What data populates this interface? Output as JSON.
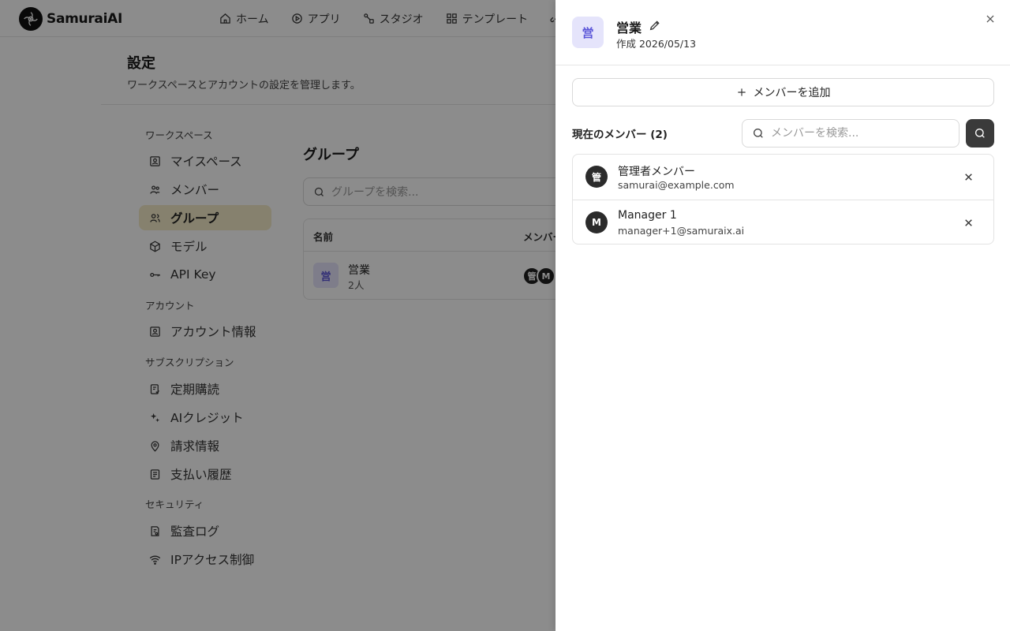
{
  "app": {
    "brand": "SamuraiAI",
    "nav": [
      {
        "label": "ホーム",
        "icon": "home-icon"
      },
      {
        "label": "アプリ",
        "icon": "play-circle-icon"
      },
      {
        "label": "スタジオ",
        "icon": "nodes-icon"
      },
      {
        "label": "テンプレート",
        "icon": "grid-icon"
      }
    ]
  },
  "settings": {
    "title": "設定",
    "subtitle": "ワークスペースとアカウントの設定を管理します。",
    "sections": {
      "workspace": "ワークスペース",
      "account": "アカウント",
      "subscription": "サブスクリプション",
      "security": "セキュリティ"
    },
    "items": {
      "myspace": "マイスペース",
      "members": "メンバー",
      "groups": "グループ",
      "models": "モデル",
      "apikey": "API Key",
      "account_info": "アカウント情報",
      "subscription_plan": "定期購読",
      "ai_credit": "AIクレジット",
      "billing": "請求情報",
      "payment_history": "支払い履歴",
      "audit_log": "監査ログ",
      "ip_access": "IPアクセス制御"
    }
  },
  "groups_page": {
    "title": "グループ",
    "search_placeholder": "グループを検索...",
    "columns": {
      "name": "名前",
      "members": "メンバー"
    },
    "rows": [
      {
        "badge": "営",
        "name": "営業",
        "count": "2人",
        "avatars": [
          "管",
          "M"
        ]
      }
    ]
  },
  "drawer": {
    "group_badge": "営",
    "group_name": "営業",
    "created": "作成 2026/05/13",
    "add_member_label": "メンバーを追加",
    "members_title": "現在のメンバー (2)",
    "member_search_placeholder": "メンバーを検索...",
    "members": [
      {
        "initial": "管",
        "name": "管理者メンバー",
        "email": "samurai@example.com"
      },
      {
        "initial": "M",
        "name": "Manager 1",
        "email": "manager+1@samuraix.ai"
      }
    ]
  },
  "colors": {
    "accent_badge_bg": "#e5e4fb",
    "accent_badge_fg": "#5a55d8",
    "active_nav_bg": "#f5ecc9",
    "dark_button": "#3a3a3a"
  }
}
